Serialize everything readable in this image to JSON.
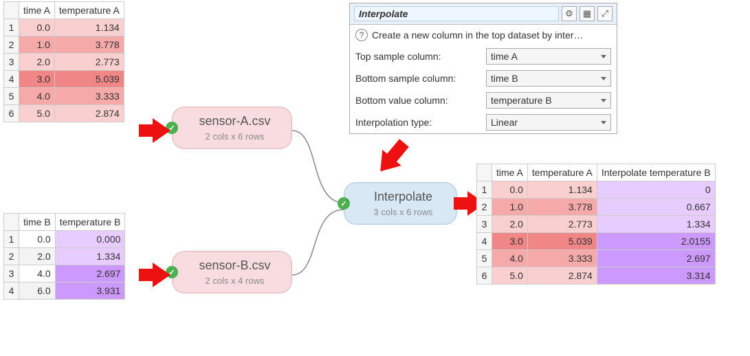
{
  "tableA": {
    "headers": [
      "time A",
      "temperature A"
    ],
    "rows": [
      {
        "n": "1",
        "t": "0.0",
        "v": "1.134"
      },
      {
        "n": "2",
        "t": "1.0",
        "v": "3.778"
      },
      {
        "n": "3",
        "t": "2.0",
        "v": "2.773"
      },
      {
        "n": "4",
        "t": "3.0",
        "v": "5.039"
      },
      {
        "n": "5",
        "t": "4.0",
        "v": "3.333"
      },
      {
        "n": "6",
        "t": "5.0",
        "v": "2.874"
      }
    ]
  },
  "tableB": {
    "headers": [
      "time B",
      "temperature B"
    ],
    "rows": [
      {
        "n": "1",
        "t": "0.0",
        "v": "0.000"
      },
      {
        "n": "2",
        "t": "2.0",
        "v": "1.334"
      },
      {
        "n": "3",
        "t": "4.0",
        "v": "2.697"
      },
      {
        "n": "4",
        "t": "6.0",
        "v": "3.931"
      }
    ]
  },
  "tableOut": {
    "headers": [
      "time A",
      "temperature A",
      "Interpolate temperature B"
    ],
    "rows": [
      {
        "n": "1",
        "t": "0.0",
        "a": "1.134",
        "b": "0"
      },
      {
        "n": "2",
        "t": "1.0",
        "a": "3.778",
        "b": "0.667"
      },
      {
        "n": "3",
        "t": "2.0",
        "a": "2.773",
        "b": "1.334"
      },
      {
        "n": "4",
        "t": "3.0",
        "a": "5.039",
        "b": "2.0155"
      },
      {
        "n": "5",
        "t": "4.0",
        "a": "3.333",
        "b": "2.697"
      },
      {
        "n": "6",
        "t": "5.0",
        "a": "2.874",
        "b": "3.314"
      }
    ]
  },
  "nodes": {
    "a": {
      "title": "sensor-A.csv",
      "sub": "2 cols x 6 rows"
    },
    "b": {
      "title": "sensor-B.csv",
      "sub": "2 cols x 4 rows"
    },
    "interp": {
      "title": "Interpolate",
      "sub": "3 cols x 6 rows"
    }
  },
  "panel": {
    "title": "Interpolate",
    "desc": "Create a new column in the top dataset by inter…",
    "field1": {
      "label": "Top sample column:",
      "value": "time A"
    },
    "field2": {
      "label": "Bottom sample column:",
      "value": "time B"
    },
    "field3": {
      "label": "Bottom value column:",
      "value": "temperature B"
    },
    "field4": {
      "label": "Interpolation type:",
      "value": "Linear"
    }
  }
}
